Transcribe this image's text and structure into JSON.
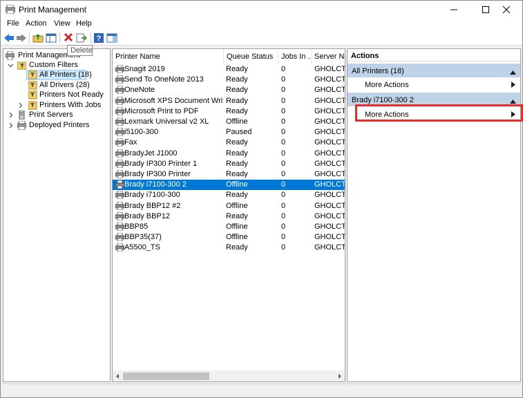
{
  "window": {
    "title": "Print Management"
  },
  "menu": [
    "File",
    "Action",
    "View",
    "Help"
  ],
  "toolbar": {
    "tooltip": "Delete"
  },
  "tree": {
    "root": "Print Management",
    "custom_filters": "Custom Filters",
    "filters": [
      "All Printers (18)",
      "All Drivers (28)",
      "Printers Not Ready",
      "Printers With Jobs"
    ],
    "print_servers": "Print Servers",
    "deployed_printers": "Deployed Printers"
  },
  "list": {
    "columns": [
      "Printer Name",
      "Queue Status",
      "Jobs In ...",
      "Server Nar"
    ],
    "rows": [
      {
        "name": "Snagit 2019",
        "status": "Ready",
        "jobs": "0",
        "server": "GHOLCTD"
      },
      {
        "name": "Send To OneNote 2013",
        "status": "Ready",
        "jobs": "0",
        "server": "GHOLCTD"
      },
      {
        "name": "OneNote",
        "status": "Ready",
        "jobs": "0",
        "server": "GHOLCTD"
      },
      {
        "name": "Microsoft XPS Document Writer",
        "status": "Ready",
        "jobs": "0",
        "server": "GHOLCTD"
      },
      {
        "name": "Microsoft Print to PDF",
        "status": "Ready",
        "jobs": "0",
        "server": "GHOLCTD"
      },
      {
        "name": "Lexmark Universal v2 XL",
        "status": "Offline",
        "jobs": "0",
        "server": "GHOLCTD"
      },
      {
        "name": "i5100-300",
        "status": "Paused",
        "jobs": "0",
        "server": "GHOLCTD"
      },
      {
        "name": "Fax",
        "status": "Ready",
        "jobs": "0",
        "server": "GHOLCTD"
      },
      {
        "name": "BradyJet J1000",
        "status": "Ready",
        "jobs": "0",
        "server": "GHOLCTD"
      },
      {
        "name": "Brady IP300 Printer 1",
        "status": "Ready",
        "jobs": "0",
        "server": "GHOLCTD"
      },
      {
        "name": "Brady IP300 Printer",
        "status": "Ready",
        "jobs": "0",
        "server": "GHOLCTD"
      },
      {
        "name": "Brady i7100-300 2",
        "status": "Offline",
        "jobs": "0",
        "server": "GHOLCTD"
      },
      {
        "name": "Brady i7100-300",
        "status": "Ready",
        "jobs": "0",
        "server": "GHOLCTD"
      },
      {
        "name": "Brady BBP12 #2",
        "status": "Offline",
        "jobs": "0",
        "server": "GHOLCTD"
      },
      {
        "name": "Brady BBP12",
        "status": "Ready",
        "jobs": "0",
        "server": "GHOLCTD"
      },
      {
        "name": "BBP85",
        "status": "Offline",
        "jobs": "0",
        "server": "GHOLCTD"
      },
      {
        "name": "BBP35(37)",
        "status": "Offline",
        "jobs": "0",
        "server": "GHOLCTD"
      },
      {
        "name": "A5500_TS",
        "status": "Ready",
        "jobs": "0",
        "server": "GHOLCTD"
      }
    ],
    "selected_index": 11
  },
  "actions": {
    "header": "Actions",
    "group1": "All Printers (18)",
    "group1_item": "More Actions",
    "group2": "Brady i7100-300 2",
    "group2_item": "More Actions"
  },
  "colors": {
    "selection": "#0078d7",
    "action_group": "#bfd3e8",
    "highlight_box": "#e82a2a"
  }
}
